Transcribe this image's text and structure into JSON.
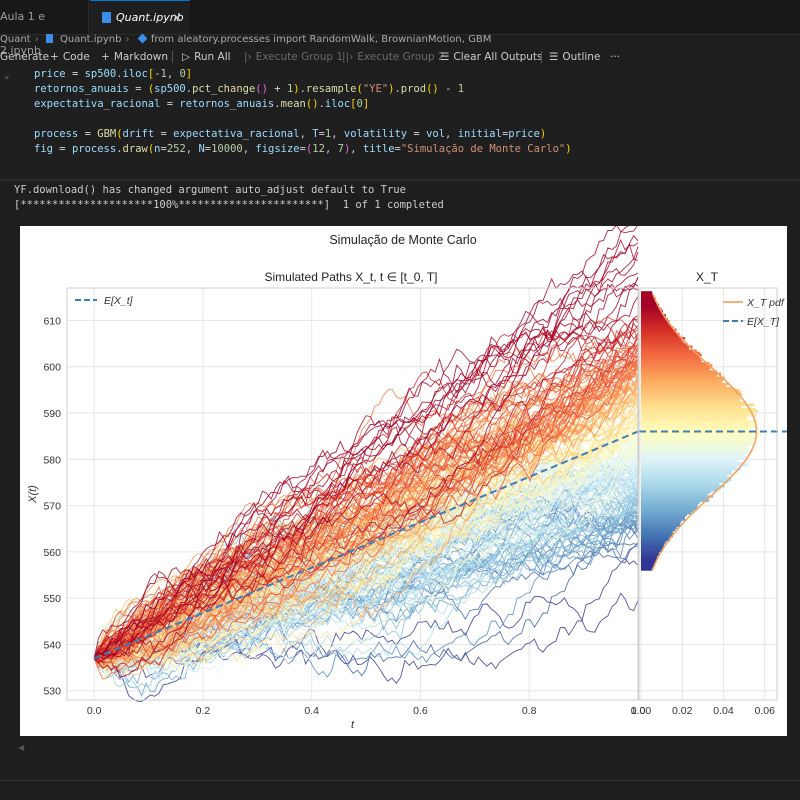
{
  "tabs": [
    {
      "label": "Aula 1 e 2.ipynb"
    },
    {
      "label": "Quant.ipynb",
      "close": "✕"
    }
  ],
  "breadcrumb": {
    "root": "Quant",
    "file": "Quant.ipynb",
    "symbol": "from aleatory.processes import RandomWalk, BrownianMotion, GBM"
  },
  "toolbar": {
    "generate": "Generate",
    "code": "Code",
    "markdown": "Markdown",
    "run_all": "Run All",
    "exec_group1": "Execute Group 1",
    "exec_group2": "Execute Group 2",
    "clear_outputs": "Clear All Outputs",
    "outline": "Outline",
    "more": "···"
  },
  "output": {
    "line1": "YF.download() has changed argument auto_adjust default to True",
    "line2": "[*********************100%***********************]  1 of 1 completed"
  },
  "colors": {
    "accent": "#0078d4",
    "mean_line": "#3a7fb8",
    "pdf_line": "#f4a460"
  },
  "chart_data": {
    "type": "line",
    "suptitle": "Simulação de Monte Carlo",
    "panels": [
      {
        "title": "Simulated Paths X_t, t ∈ [t_0, T]",
        "xlabel": "t",
        "ylabel": "X(t)",
        "xlim": [
          -0.05,
          1.0
        ],
        "ylim": [
          528,
          617
        ],
        "xticks": [
          "0.0",
          "0.2",
          "0.4",
          "0.6",
          "0.8",
          "1.0"
        ],
        "yticks": [
          "530",
          "540",
          "550",
          "560",
          "570",
          "580",
          "590",
          "600",
          "610"
        ],
        "grid": true,
        "legend": [
          "E[X_t]"
        ],
        "legend_position": "top-left",
        "initial_value": 537,
        "expected_value_at_T": 586,
        "terminal_range": [
          558,
          613
        ],
        "colormap": "RdYlBu",
        "series": [
          {
            "name": "E[X_t]",
            "x": [
              0,
              1.0
            ],
            "y": [
              537,
              586
            ],
            "style": "dashed"
          }
        ]
      },
      {
        "title": "X_T",
        "xlim": [
          0,
          0.065
        ],
        "xticks": [
          "0.00",
          "0.02",
          "0.04",
          "0.06"
        ],
        "legend": [
          "X_T pdf",
          "E[X_T]"
        ],
        "legend_position": "top-right",
        "pdf_peak_density": 0.056,
        "pdf_peak_value": 586,
        "expected_value": 586
      }
    ]
  }
}
